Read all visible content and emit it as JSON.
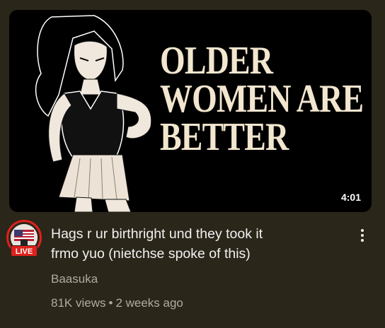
{
  "video": {
    "thumbnail_text": [
      "OLDER",
      "WOMEN ARE",
      "BETTER"
    ],
    "duration": "4:01",
    "title_line1": "Hags r ur birthright und they took it",
    "title_line2": "frmo yuo (nietchse spoke of this)",
    "channel": "Baasuka",
    "views": "81K views",
    "separator": "•",
    "age": "2 weeks ago",
    "live_label": "LIVE"
  },
  "icons": {
    "menu": "more-vert-icon",
    "avatar": "channel-avatar"
  },
  "colors": {
    "background": "#2a2619",
    "live_red": "#e0201c",
    "thumbnail_text": "#f2e6cf"
  }
}
